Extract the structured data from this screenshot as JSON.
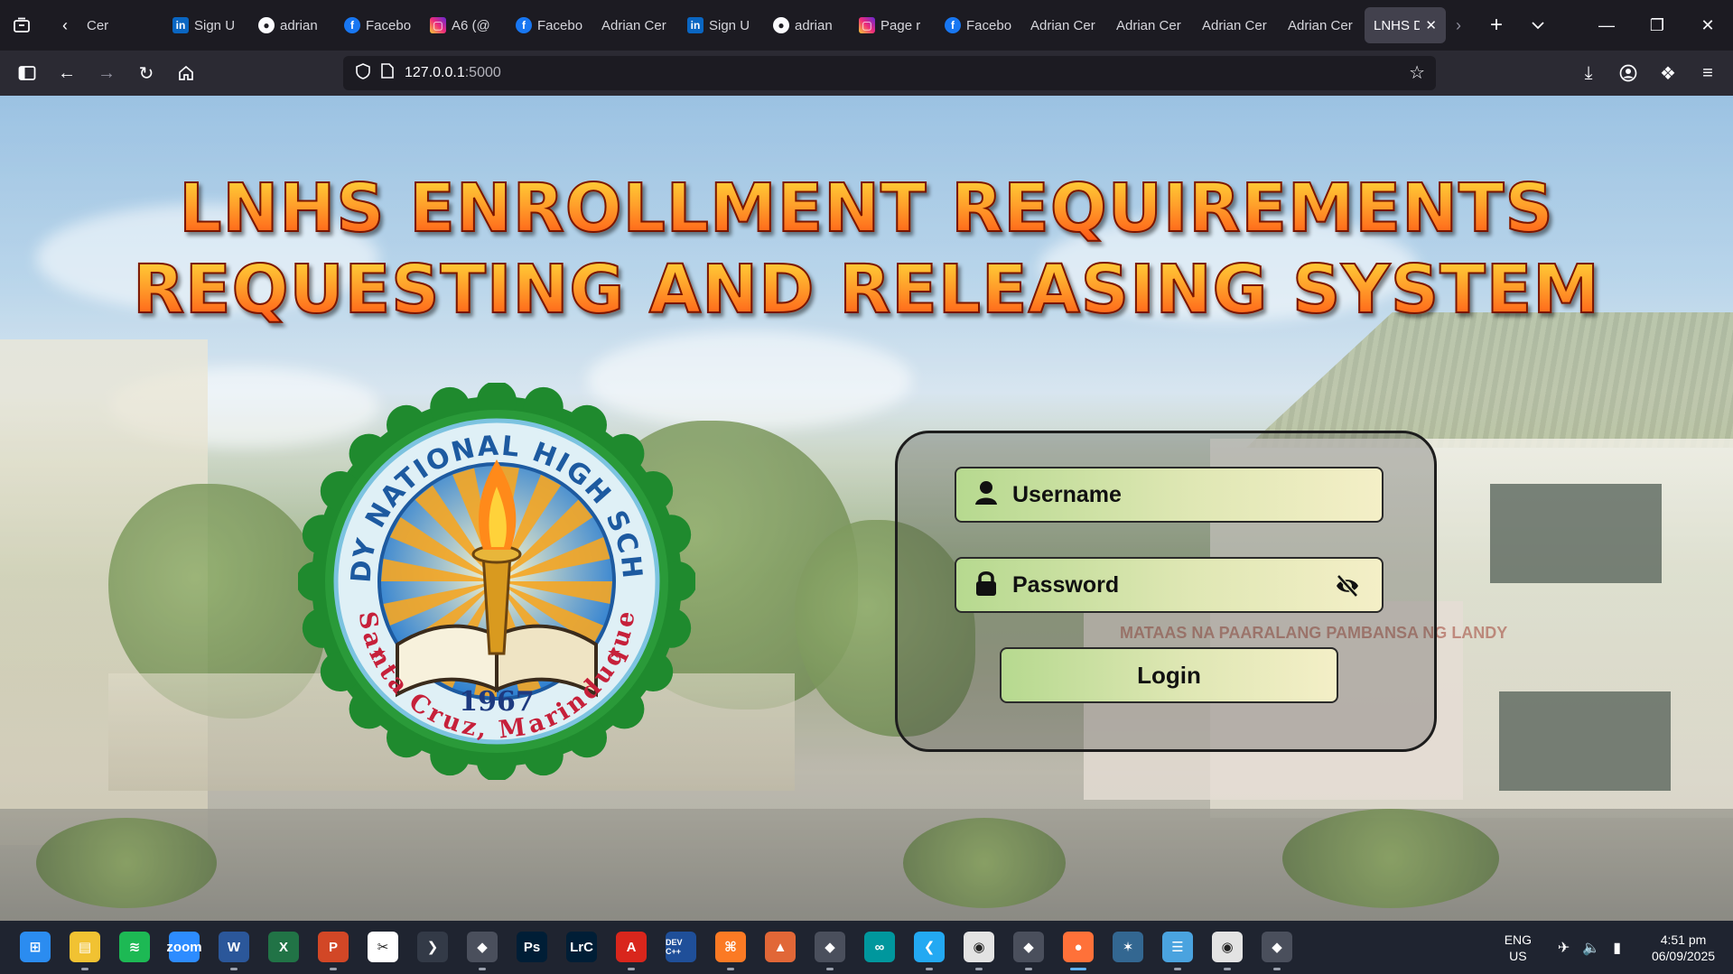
{
  "browser": {
    "tabs": [
      {
        "label": "Cer",
        "favicon": "none"
      },
      {
        "label": "Sign U",
        "favicon": "linkedin-icon"
      },
      {
        "label": "adrian",
        "favicon": "github-icon"
      },
      {
        "label": "Facebo",
        "favicon": "facebook-icon"
      },
      {
        "label": "A6 (@",
        "favicon": "instagram-icon"
      },
      {
        "label": "Facebo",
        "favicon": "facebook-icon"
      },
      {
        "label": "Adrian Cer",
        "favicon": "none"
      },
      {
        "label": "Sign U",
        "favicon": "linkedin-icon"
      },
      {
        "label": "adrian",
        "favicon": "github-icon"
      },
      {
        "label": "Page r",
        "favicon": "instagram-icon"
      },
      {
        "label": "Facebo",
        "favicon": "facebook-icon"
      },
      {
        "label": "Adrian Cer",
        "favicon": "none"
      },
      {
        "label": "Adrian Cer",
        "favicon": "none"
      },
      {
        "label": "Adrian Cer",
        "favicon": "none"
      },
      {
        "label": "Adrian Cer",
        "favicon": "none"
      },
      {
        "label": "LNHS D",
        "favicon": "none",
        "active": true
      }
    ],
    "url_host": "127.0.0.1",
    "url_port": ":5000"
  },
  "page": {
    "title_line1": "LNHS ENROLLMENT REQUIREMENTS",
    "title_line2": "REQUESTING AND RELEASING SYSTEM",
    "logo": {
      "top_text": "LANDY NATIONAL HIGH SCHOOL",
      "year": "1967",
      "bottom_text": "Santa Cruz, Marinduque"
    },
    "sign_text": "MATAAS NA PAARALANG PAMBANSA NG LANDY",
    "login": {
      "username_placeholder": "Username",
      "password_placeholder": "Password",
      "button_label": "Login"
    }
  },
  "taskbar": {
    "apps": [
      "start-icon",
      "file-explorer-icon",
      "spotify-icon",
      "zoom-icon",
      "word-icon",
      "excel-icon",
      "powerpoint-icon",
      "capcut-icon",
      "terminal-icon",
      "app-icon",
      "photoshop-icon",
      "lightroom-icon",
      "acrobat-icon",
      "devc-icon",
      "xampp-icon",
      "matlab-icon",
      "app-icon",
      "arduino-icon",
      "vscode-icon",
      "chrome-icon",
      "app-icon",
      "firefox-icon",
      "mysql-workbench-icon",
      "notepad-icon",
      "chrome-icon",
      "app-icon"
    ],
    "labels": {
      "zoom": "zoom",
      "photoshop": "Ps",
      "lightroom": "LrC",
      "devc": "DEV C++"
    },
    "language": "ENG",
    "region": "US",
    "time": "4:51 pm",
    "date": "06/09/2025"
  },
  "colors": {
    "title_fill": "#ff7a1a",
    "field_gradient_start": "#b6d98f",
    "field_gradient_end": "#f4efc7",
    "taskbar": "#1f2430"
  }
}
